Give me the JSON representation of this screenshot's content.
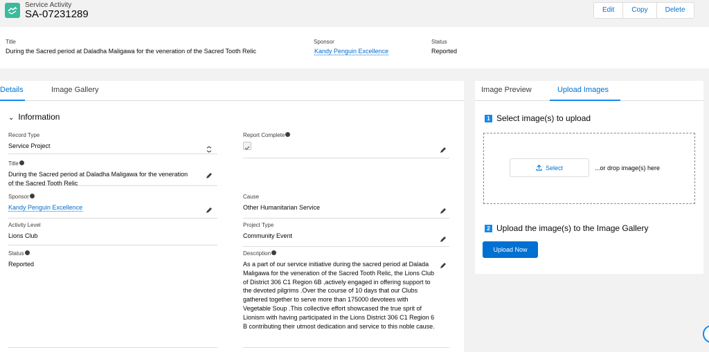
{
  "header": {
    "object_label": "Service Activity",
    "record_name": "SA-07231289",
    "buttons": [
      "Edit",
      "Copy",
      "Delete"
    ]
  },
  "highlights": {
    "title_label": "Title",
    "title_value": "During the Sacred period at Daladha Maligawa for the veneration of the Sacred Tooth Relic",
    "sponsor_label": "Sponsor",
    "sponsor_value": "Kandy Penguin Excellence",
    "status_label": "Status",
    "status_value": "Reported"
  },
  "left_tabs": [
    "Details",
    "Image Gallery"
  ],
  "section_title": "Information",
  "fields": {
    "record_type": {
      "label": "Record Type",
      "value": "Service Project"
    },
    "report_complete": {
      "label": "Report Complete",
      "checked": true
    },
    "title": {
      "label": "Title",
      "value": "During the Sacred period at Daladha Maligawa for the veneration of the Sacred Tooth Relic"
    },
    "sponsor": {
      "label": "Sponsor",
      "value": "Kandy Penguin Excellence"
    },
    "cause": {
      "label": "Cause",
      "value": "Other Humanitarian Service"
    },
    "activity_level": {
      "label": "Activity Level",
      "value": "Lions Club"
    },
    "project_type": {
      "label": "Project Type",
      "value": "Community Event"
    },
    "status": {
      "label": "Status",
      "value": "Reported"
    },
    "description": {
      "label": "Description",
      "value": "As a part of our service initiative during the sacred period at Dalada Maligawa for the veneration of the Sacred Tooth Relic, the Lions Club of District 306 C1 Region 6B ,actively engaged in offering support to the devoted pilgrims .Over the course of 10 days that our Clubs gathered together to serve more than 175000 devotees with Vegetable Soup .This collective effort showcased the true sprit of Lionism with having participated in the Lions District 306 C1 Region 6 B contributing their utmost dedication and service to this noble cause."
    }
  },
  "right_tabs": [
    "Image Preview",
    "Upload Images"
  ],
  "upload": {
    "step1_num": "1",
    "step1_text": "Select image(s) to upload",
    "select_label": "Select",
    "drop_hint": "...or drop image(s) here",
    "step2_num": "2",
    "step2_text": "Upload the image(s) to the Image Gallery",
    "upload_button": "Upload Now"
  },
  "colors": {
    "accent": "#0070d2",
    "tab_underline": "#1589ee",
    "icon_bg": "#3bba9c"
  }
}
